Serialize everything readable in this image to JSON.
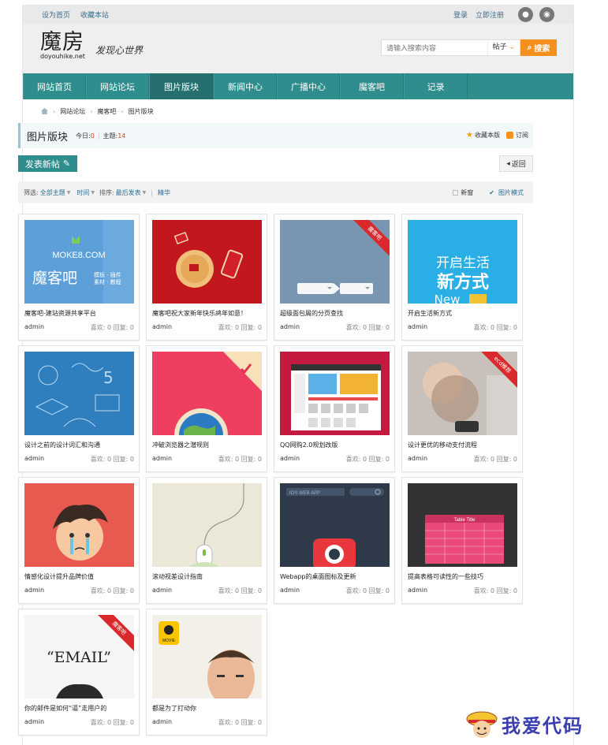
{
  "topbar": {
    "set_home": "设为首页",
    "bookmark": "收藏本站",
    "login": "登录",
    "register": "立即注册"
  },
  "logo": {
    "mark": "魔房",
    "domain": "doyouhike.net",
    "slogan": "发现心世界"
  },
  "search": {
    "placeholder": "请输入搜索内容",
    "type": "帖子",
    "button": "搜索"
  },
  "nav": [
    "网站首页",
    "网站论坛",
    "图片版块",
    "新闻中心",
    "广播中心",
    "魔客吧",
    "记录"
  ],
  "breadcrumb": [
    "网站论坛",
    "魔客吧",
    "图片版块"
  ],
  "forum": {
    "title": "图片版块",
    "today_label": "今日:",
    "today": "0",
    "topics_label": "主题:",
    "topics": "14",
    "fav": "收藏本版",
    "sub": "订阅"
  },
  "post_button": "发表新帖",
  "back_button": "返回",
  "filter": {
    "label": "筛选:",
    "all": "全部主题",
    "time": "时间",
    "sort_label": "排序:",
    "sort": "最后发表",
    "digest": "精华",
    "new": "新窗",
    "pic_mode": "图片模式"
  },
  "cards": [
    {
      "title": "魔客吧-建站资源共享平台",
      "author": "admin",
      "stats": "喜欢: 0 回复: 0"
    },
    {
      "title": "魔客吧祝大家新年快乐鸪年如意！",
      "author": "admin",
      "stats": "喜欢: 0 回复: 0"
    },
    {
      "title": "超级面包屑的分页查找",
      "author": "admin",
      "stats": "喜欢: 0 回复: 0"
    },
    {
      "title": "开启生活新方式",
      "author": "admin",
      "stats": "喜欢: 0 回复: 0"
    },
    {
      "title": "设计之前的设计词汇和沟通",
      "author": "admin",
      "stats": "喜欢: 0 回复: 0"
    },
    {
      "title": "冲破浏览器之潜规则",
      "author": "admin",
      "stats": "喜欢: 0 回复: 0"
    },
    {
      "title": "QQ网购2.0规划改版",
      "author": "admin",
      "stats": "喜欢: 0 回复: 0"
    },
    {
      "title": "设计更优的移动支付流程",
      "author": "admin",
      "stats": "喜欢: 0 回复: 0"
    },
    {
      "title": "情感化设计提升品牌价值",
      "author": "admin",
      "stats": "喜欢: 0 回复: 0"
    },
    {
      "title": "滚动视差设计指南",
      "author": "admin",
      "stats": "喜欢: 0 回复: 0"
    },
    {
      "title": "Webapp的桌面图标及更新",
      "author": "admin",
      "stats": "喜欢: 0 回复: 0"
    },
    {
      "title": "提高表格可读性的一些技巧",
      "author": "admin",
      "stats": "喜欢: 0 回复: 0"
    },
    {
      "title": "你的邮件是如何“逼”走用户的",
      "author": "admin",
      "stats": "喜欢: 0 回复: 0"
    },
    {
      "title": "都是为了打动你",
      "author": "admin",
      "stats": "喜欢: 0 回复: 0"
    }
  ],
  "thumb_text": {
    "moke_site": "MOKE8.COM",
    "moke_name": "魔客吧",
    "moke_tags": "模板 · 插件\n素材 · 教程",
    "life1": "开启生活",
    "life2": "新方式",
    "life3": "New",
    "email": "“EMAIL”",
    "ios": "IOS WEB APP",
    "table": "Table Title",
    "movie": "MOVIE"
  },
  "corner_badge": "魔客吧",
  "corner_badge_ecd": "ecd推荐",
  "watermark": "我爱代码"
}
